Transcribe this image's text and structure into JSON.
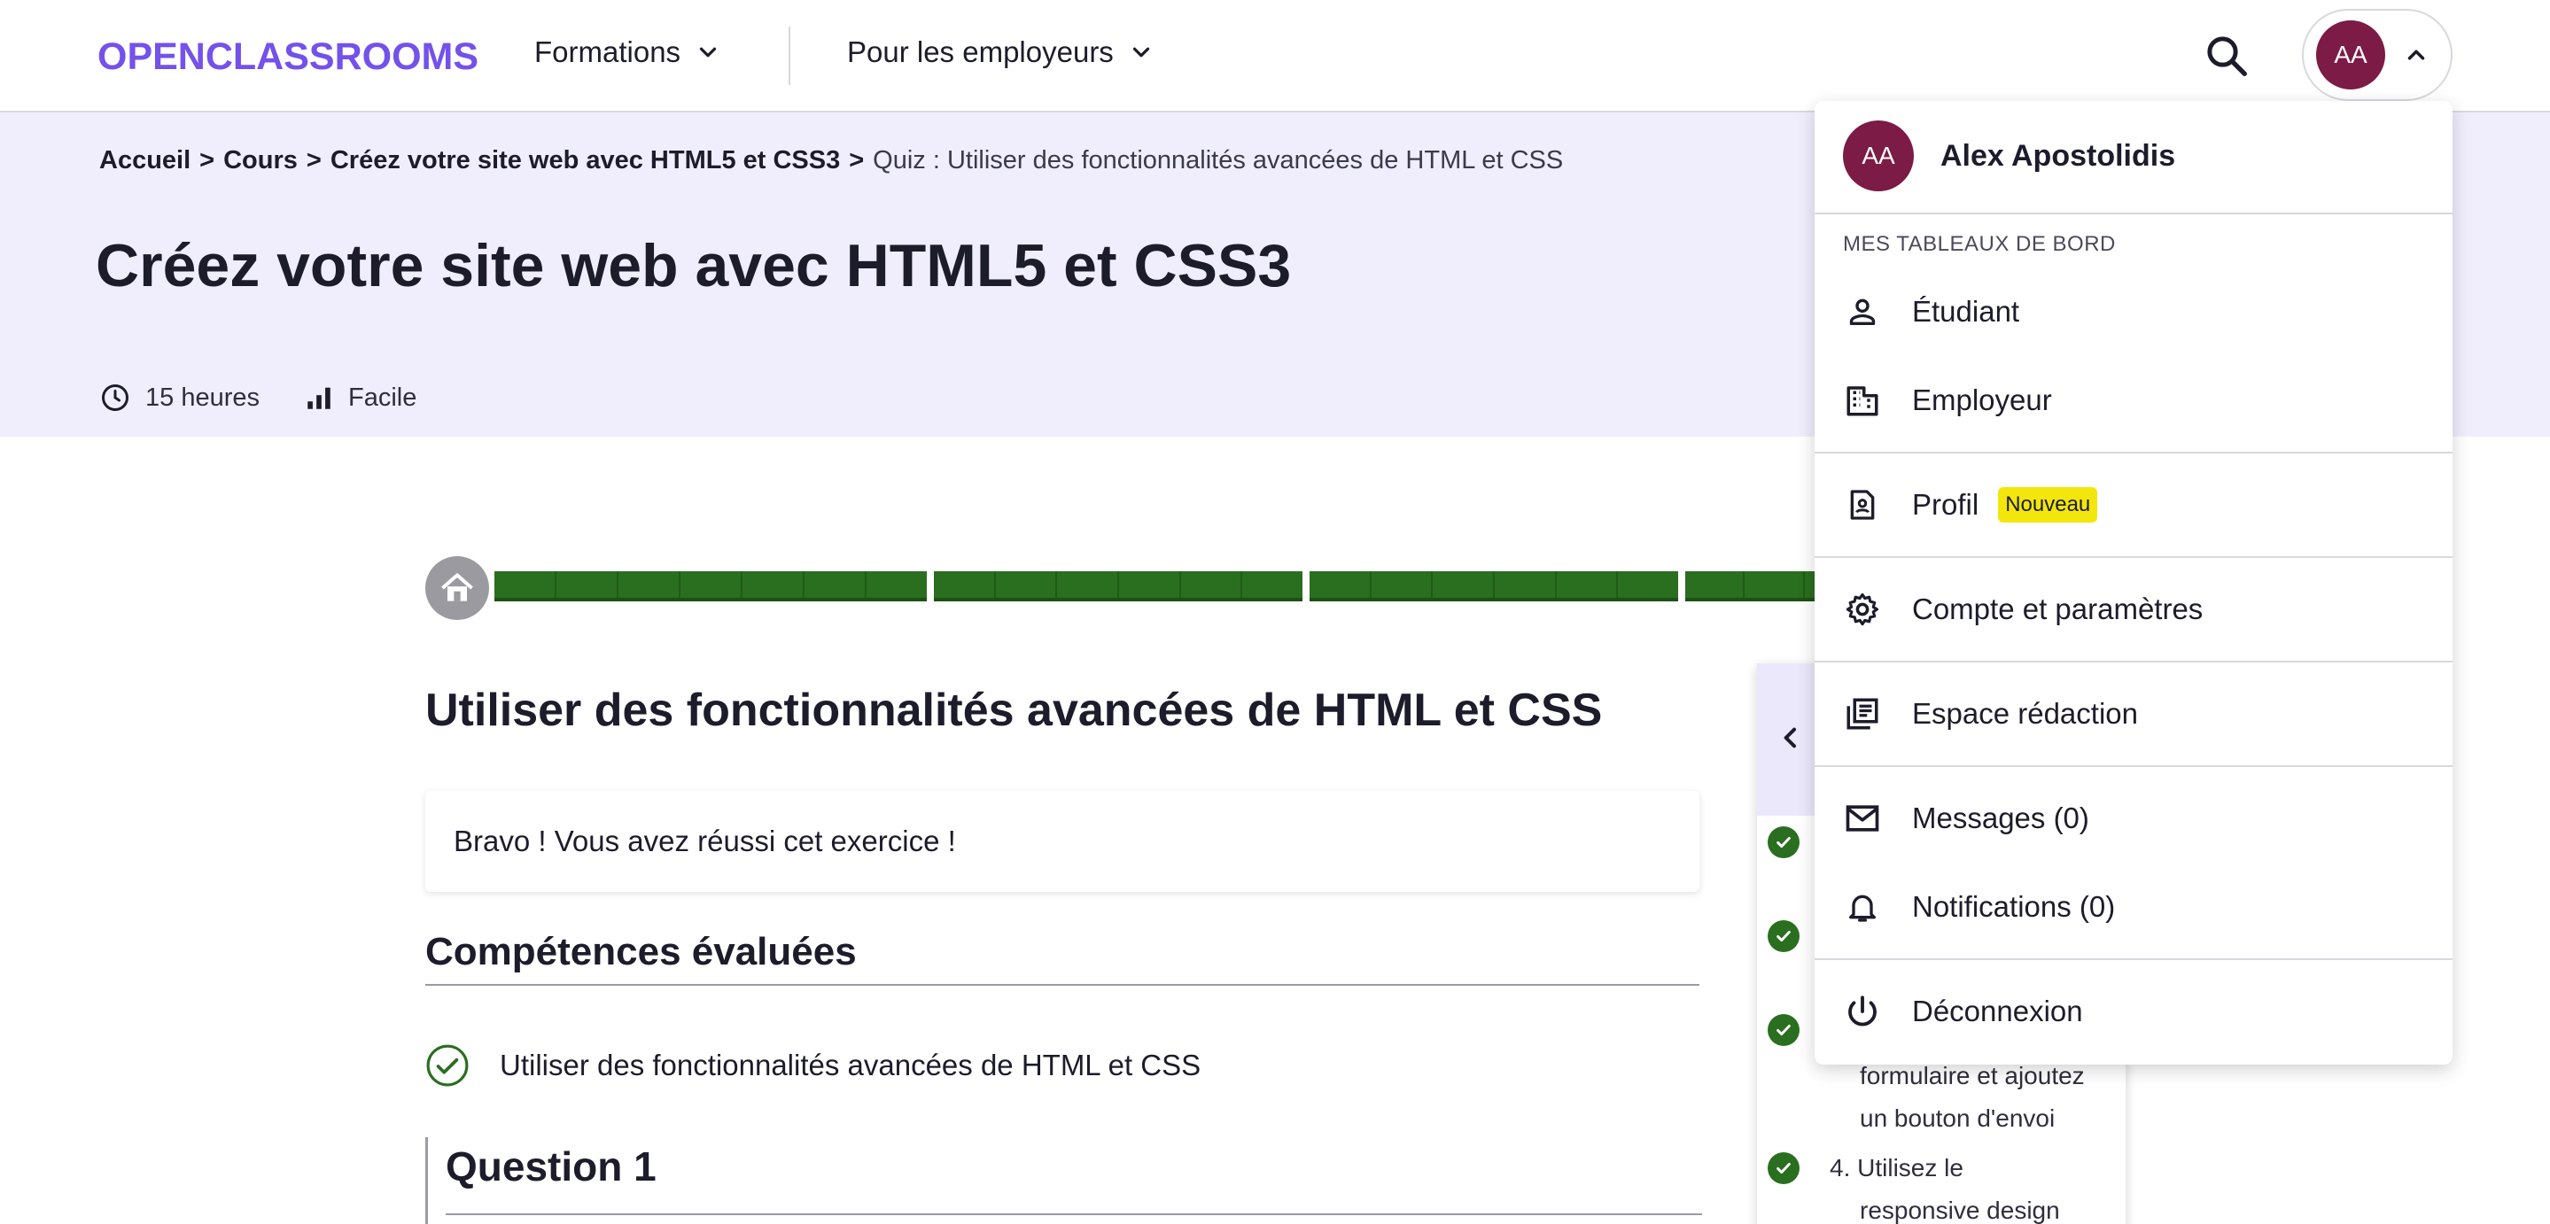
{
  "header": {
    "logo": "OPENCLASSROOMS",
    "nav": [
      {
        "label": "Formations",
        "icon": "chevron-down-icon"
      },
      {
        "label": "Pour les employeurs",
        "icon": "chevron-down-icon"
      }
    ],
    "user_initials": "AA"
  },
  "breadcrumb": {
    "items": [
      "Accueil",
      "Cours",
      "Créez votre site web avec HTML5 et CSS3"
    ],
    "separator": ">",
    "current": "Quiz : Utiliser des fonctionnalités avancées de HTML et CSS"
  },
  "course": {
    "title": "Créez votre site web avec HTML5 et CSS3",
    "duration": "15 heures",
    "level": "Facile"
  },
  "progress": {
    "segments_completed": 4
  },
  "activity": {
    "title": "Utiliser des fonctionnalités avancées de HTML et CSS",
    "result": "Bravo ! Vous avez réussi cet exercice !",
    "skills_title": "Compétences évaluées",
    "skills": [
      "Utiliser des fonctionnalités avancées de HTML et CSS"
    ],
    "question_title": "Question 1"
  },
  "side_panel": {
    "items_visible_text": [
      {
        "line1": "formulaire et ajoutez",
        "line2": "un bouton d'envoi"
      },
      {
        "number": "4.",
        "line1": "Utilisez le",
        "line2": "responsive design"
      }
    ]
  },
  "user_menu": {
    "initials": "AA",
    "name": "Alex Apostolidis",
    "section_label": "MES TABLEAUX DE BORD",
    "items": [
      {
        "label": "Étudiant",
        "icon": "person-icon"
      },
      {
        "label": "Employeur",
        "icon": "building-icon"
      },
      {
        "label": "Profil",
        "icon": "profile-document-icon",
        "badge": "Nouveau"
      },
      {
        "label": "Compte et paramètres",
        "icon": "gear-icon"
      },
      {
        "label": "Espace rédaction",
        "icon": "editorial-icon"
      },
      {
        "label": "Messages (0)",
        "icon": "mail-icon"
      },
      {
        "label": "Notifications (0)",
        "icon": "bell-icon"
      },
      {
        "label": "Déconnexion",
        "icon": "power-icon"
      }
    ]
  },
  "colors": {
    "brand": "#7451eb",
    "hero_bg": "#f0eefd",
    "progress": "#2a6e1f",
    "avatar": "#7b1b46",
    "badge": "#f2e60c"
  }
}
